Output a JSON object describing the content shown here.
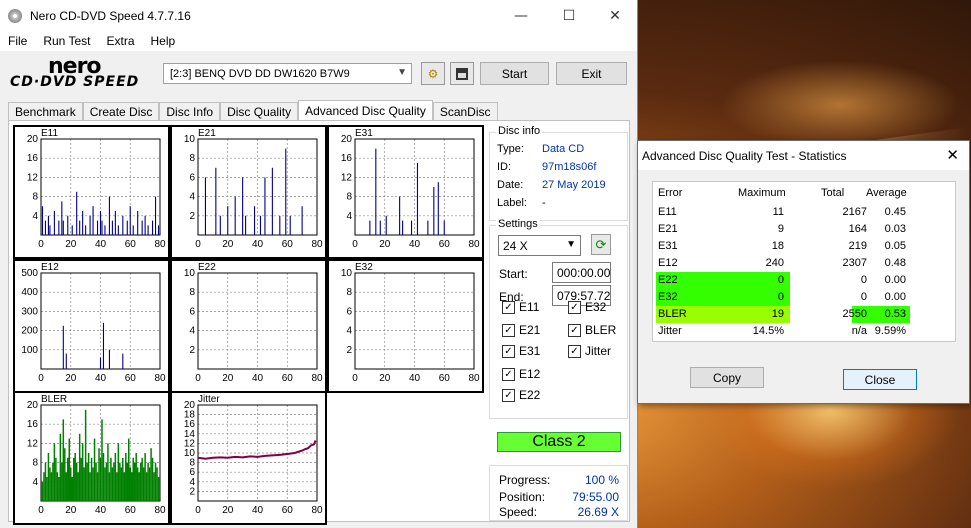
{
  "window": {
    "title": "Nero CD-DVD Speed 4.7.7.16",
    "minimize": "—",
    "maximize": "☐",
    "close": "✕"
  },
  "menu": [
    "File",
    "Run Test",
    "Extra",
    "Help"
  ],
  "logo": {
    "top": "nero",
    "bottom": "CD·DVD SPEED"
  },
  "drive": {
    "selected": "[2:3]   BENQ DVD DD DW1620 B7W9"
  },
  "toolbar": {
    "start_label": "Start",
    "exit_label": "Exit"
  },
  "tabs": [
    "Benchmark",
    "Create Disc",
    "Disc Info",
    "Disc Quality",
    "Advanced Disc Quality",
    "ScanDisc"
  ],
  "active_tab": "Advanced Disc Quality",
  "disc_info": {
    "title": "Disc info",
    "type_label": "Type:",
    "type": "Data CD",
    "id_label": "ID:",
    "id": "97m18s06f",
    "date_label": "Date:",
    "date": "27 May 2019",
    "label_label": "Label:",
    "label": "-"
  },
  "settings": {
    "title": "Settings",
    "speed": "24 X",
    "start_label": "Start:",
    "start": "000:00.00",
    "end_label": "End:",
    "end": "079:57.72",
    "checks": [
      {
        "label": "E11",
        "checked": true
      },
      {
        "label": "E32",
        "checked": true
      },
      {
        "label": "E21",
        "checked": true
      },
      {
        "label": "BLER",
        "checked": true
      },
      {
        "label": "E31",
        "checked": true
      },
      {
        "label": "Jitter",
        "checked": true
      },
      {
        "label": "E12",
        "checked": true
      },
      {
        "label": "E22",
        "checked": true
      }
    ]
  },
  "class_result": "Class 2",
  "progress": {
    "progress_label": "Progress:",
    "progress": "100 %",
    "position_label": "Position:",
    "position": "79:55.00",
    "speed_label": "Speed:",
    "speed": "26.69 X"
  },
  "chart_data": [
    {
      "type": "bar",
      "title": "E11",
      "ylim": [
        0,
        20
      ],
      "yticks": [
        4,
        8,
        12,
        16,
        20
      ],
      "xlim": [
        0,
        80
      ],
      "xticks": [
        0,
        20,
        40,
        60,
        80
      ],
      "color": "#00008b",
      "x": [
        1,
        3,
        5,
        6,
        9,
        12,
        14,
        15,
        18,
        21,
        24,
        26,
        28,
        30,
        33,
        35,
        38,
        40,
        41,
        43,
        46,
        48,
        50,
        52,
        55,
        58,
        60,
        62,
        65,
        68,
        70,
        72,
        75,
        77,
        79
      ],
      "values": [
        6,
        3,
        4,
        2,
        5,
        3,
        7,
        3,
        4,
        2,
        9,
        3,
        5,
        2,
        4,
        6,
        3,
        5,
        3,
        2,
        8,
        3,
        5,
        2,
        4,
        3,
        6,
        2,
        5,
        3,
        4,
        2,
        3,
        8,
        2
      ]
    },
    {
      "type": "bar",
      "title": "E21",
      "ylim": [
        0,
        10
      ],
      "yticks": [
        2,
        4,
        6,
        8,
        10
      ],
      "xlim": [
        0,
        80
      ],
      "xticks": [
        0,
        20,
        40,
        60,
        80
      ],
      "color": "#00008b",
      "x": [
        5,
        12,
        15,
        20,
        25,
        30,
        32,
        38,
        42,
        45,
        50,
        55,
        59,
        62,
        70
      ],
      "values": [
        6,
        7,
        2,
        3,
        4,
        6,
        2,
        3,
        2,
        6,
        7,
        2,
        9,
        2,
        3
      ]
    },
    {
      "type": "bar",
      "title": "E31",
      "ylim": [
        0,
        20
      ],
      "yticks": [
        4,
        8,
        12,
        16,
        20
      ],
      "xlim": [
        0,
        80
      ],
      "xticks": [
        0,
        20,
        40,
        60,
        80
      ],
      "color": "#00008b",
      "x": [
        10,
        14,
        17,
        21,
        30,
        32,
        38,
        42,
        49,
        53,
        56,
        60
      ],
      "values": [
        3,
        18,
        3,
        4,
        8,
        3,
        3,
        15,
        3,
        10,
        11,
        3
      ]
    },
    {
      "type": "bar",
      "title": "E12",
      "ylim": [
        0,
        500
      ],
      "yticks": [
        100,
        200,
        300,
        400,
        500
      ],
      "xlim": [
        0,
        80
      ],
      "xticks": [
        0,
        20,
        40,
        60,
        80
      ],
      "color": "#00008b",
      "x": [
        15,
        17,
        40,
        42,
        46,
        55
      ],
      "values": [
        225,
        80,
        60,
        240,
        100,
        80
      ]
    },
    {
      "type": "bar",
      "title": "E22",
      "ylim": [
        0,
        10
      ],
      "yticks": [
        2,
        4,
        6,
        8,
        10
      ],
      "xlim": [
        0,
        80
      ],
      "xticks": [
        0,
        20,
        40,
        60,
        80
      ],
      "color": "#00008b",
      "x": [],
      "values": []
    },
    {
      "type": "bar",
      "title": "E32",
      "ylim": [
        0,
        10
      ],
      "yticks": [
        2,
        4,
        6,
        8,
        10
      ],
      "xlim": [
        0,
        80
      ],
      "xticks": [
        0,
        20,
        40,
        60,
        80
      ],
      "color": "#00008b",
      "x": [],
      "values": []
    },
    {
      "type": "bar",
      "title": "BLER",
      "ylim": [
        0,
        20
      ],
      "yticks": [
        4,
        8,
        12,
        16,
        20
      ],
      "xlim": [
        0,
        80
      ],
      "xticks": [
        0,
        20,
        40,
        60,
        80
      ],
      "color": "#008000",
      "x": [
        1,
        2,
        3,
        4,
        5,
        6,
        7,
        8,
        9,
        10,
        11,
        12,
        13,
        14,
        15,
        16,
        17,
        18,
        19,
        20,
        21,
        22,
        23,
        24,
        25,
        26,
        27,
        28,
        29,
        30,
        31,
        32,
        33,
        34,
        35,
        36,
        37,
        38,
        39,
        40,
        41,
        42,
        43,
        44,
        45,
        46,
        47,
        48,
        49,
        50,
        51,
        52,
        53,
        54,
        55,
        56,
        57,
        58,
        59,
        60,
        61,
        62,
        63,
        64,
        65,
        66,
        67,
        68,
        69,
        70,
        71,
        72,
        73,
        74,
        75,
        76,
        77,
        78,
        79
      ],
      "values": [
        4,
        6,
        8,
        5,
        10,
        7,
        6,
        8,
        12,
        9,
        6,
        5,
        14,
        8,
        17,
        11,
        6,
        9,
        13,
        7,
        5,
        9,
        10,
        8,
        6,
        14,
        9,
        12,
        7,
        19,
        8,
        10,
        6,
        9,
        7,
        13,
        8,
        6,
        11,
        9,
        17,
        10,
        7,
        8,
        12,
        6,
        9,
        7,
        8,
        10,
        6,
        12,
        8,
        7,
        9,
        6,
        10,
        8,
        13,
        7,
        6,
        9,
        8,
        10,
        7,
        6,
        8,
        9,
        7,
        10,
        6,
        8,
        7,
        11,
        9,
        6,
        8,
        7,
        5
      ]
    },
    {
      "type": "line",
      "title": "Jitter",
      "ylim": [
        0,
        20
      ],
      "yticks": [
        2,
        4,
        6,
        8,
        10,
        12,
        14,
        16,
        18,
        20
      ],
      "xlim": [
        0,
        80
      ],
      "xticks": [
        0,
        20,
        40,
        60,
        80
      ],
      "color": "#800040",
      "x": [
        0,
        5,
        10,
        15,
        20,
        25,
        30,
        35,
        40,
        45,
        50,
        55,
        60,
        65,
        70,
        72,
        74,
        76,
        78,
        79
      ],
      "values": [
        9.0,
        8.8,
        9.0,
        9.1,
        9.0,
        9.2,
        9.1,
        9.3,
        9.2,
        9.4,
        9.5,
        9.6,
        9.8,
        10.0,
        10.5,
        10.8,
        11.0,
        11.6,
        11.8,
        12.6
      ]
    }
  ],
  "stats": {
    "title": "Advanced Disc Quality Test - Statistics",
    "headers": [
      "Error",
      "Maximum",
      "Total",
      "Average"
    ],
    "rows": [
      {
        "name": "E11",
        "max": "11",
        "total": "2167",
        "avg": "0.45"
      },
      {
        "name": "E21",
        "max": "9",
        "total": "164",
        "avg": "0.03"
      },
      {
        "name": "E31",
        "max": "18",
        "total": "219",
        "avg": "0.05"
      },
      {
        "name": "E12",
        "max": "240",
        "total": "2307",
        "avg": "0.48"
      },
      {
        "name": "E22",
        "max": "0",
        "total": "0",
        "avg": "0.00"
      },
      {
        "name": "E32",
        "max": "0",
        "total": "0",
        "avg": "0.00"
      },
      {
        "name": "BLER",
        "max": "19",
        "total": "2550",
        "avg": "0.53"
      },
      {
        "name": "Jitter",
        "max": "14.5%",
        "total": "n/a",
        "avg": "9.59%"
      }
    ],
    "copy_label": "Copy",
    "close_label": "Close"
  },
  "colors": {
    "class_badge": "#66ff33",
    "highlight_green": "#33ff00",
    "highlight_yellow": "#99ff00"
  }
}
